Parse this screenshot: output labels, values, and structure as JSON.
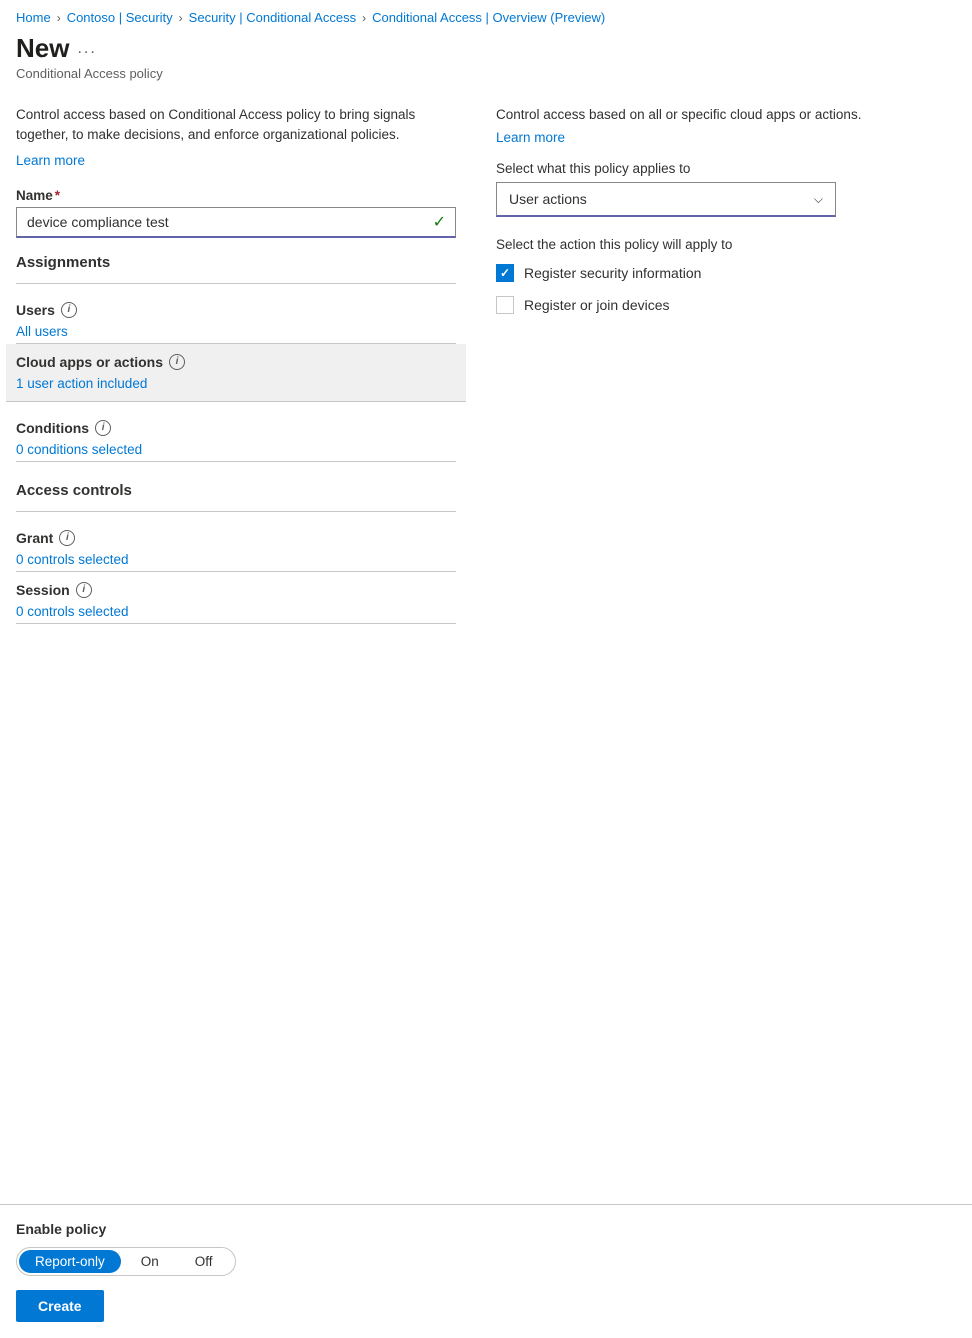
{
  "breadcrumb": {
    "items": [
      {
        "label": "Home",
        "id": "home"
      },
      {
        "label": "Contoso | Security",
        "id": "contoso-security"
      },
      {
        "label": "Security | Conditional Access",
        "id": "security-conditional-access"
      },
      {
        "label": "Conditional Access | Overview (Preview)",
        "id": "ca-overview"
      }
    ],
    "separators": [
      ">",
      ">",
      ">"
    ]
  },
  "header": {
    "title": "New",
    "ellipsis": "...",
    "subtitle": "Conditional Access policy"
  },
  "left_panel": {
    "description": "Control access based on Conditional Access policy to bring signals together, to make decisions, and enforce organizational policies.",
    "learn_more": "Learn more",
    "name_label": "Name",
    "name_placeholder": "device compliance test",
    "assignments_header": "Assignments",
    "users_label": "Users",
    "users_value": "All users",
    "cloud_apps_label": "Cloud apps or actions",
    "cloud_apps_value": "1 user action included",
    "conditions_label": "Conditions",
    "conditions_value": "0 conditions selected",
    "access_controls_header": "Access controls",
    "grant_label": "Grant",
    "grant_value": "0 controls selected",
    "session_label": "Session",
    "session_value": "0 controls selected"
  },
  "right_panel": {
    "description": "Control access based on all or specific cloud apps or actions.",
    "learn_more": "Learn more",
    "select_applies_label": "Select what this policy applies to",
    "dropdown_value": "User actions",
    "select_action_label": "Select the action this policy will apply to",
    "checkboxes": [
      {
        "id": "register-security",
        "label": "Register security information",
        "checked": true
      },
      {
        "id": "register-join",
        "label": "Register or join devices",
        "checked": false
      }
    ]
  },
  "bottom_bar": {
    "enable_label": "Enable policy",
    "toggle_options": [
      {
        "label": "Report-only",
        "active": true
      },
      {
        "label": "On",
        "active": false
      },
      {
        "label": "Off",
        "active": false
      }
    ],
    "create_button": "Create"
  }
}
